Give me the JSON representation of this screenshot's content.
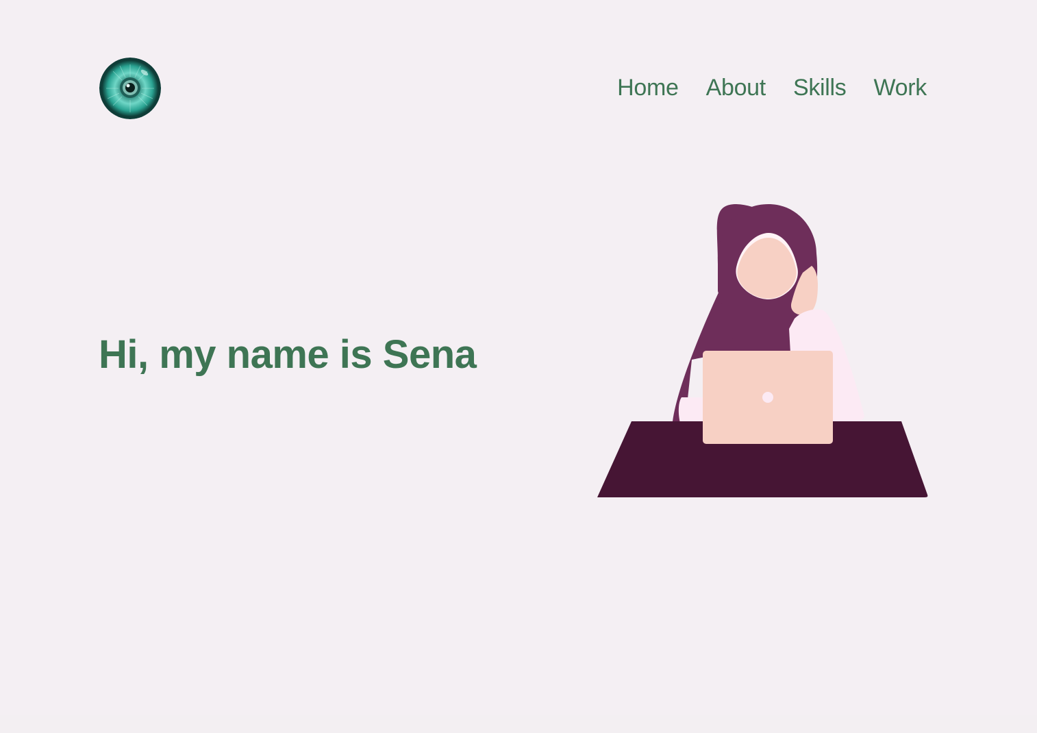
{
  "header": {
    "logo_icon": "eye-icon",
    "nav": [
      {
        "label": "Home"
      },
      {
        "label": "About"
      },
      {
        "label": "Skills"
      },
      {
        "label": "Work"
      }
    ]
  },
  "hero": {
    "title": "Hi, my name is Sena",
    "illustration": "woman-with-laptop-illustration"
  },
  "colors": {
    "background": "#f4eff3",
    "accent_green": "#3e7554",
    "hijab": "#6e2e5a",
    "desk": "#461534",
    "skin_laptop": "#f7d0c4",
    "sleeve": "#fceaf4",
    "eye_teal": "#2aa392"
  }
}
